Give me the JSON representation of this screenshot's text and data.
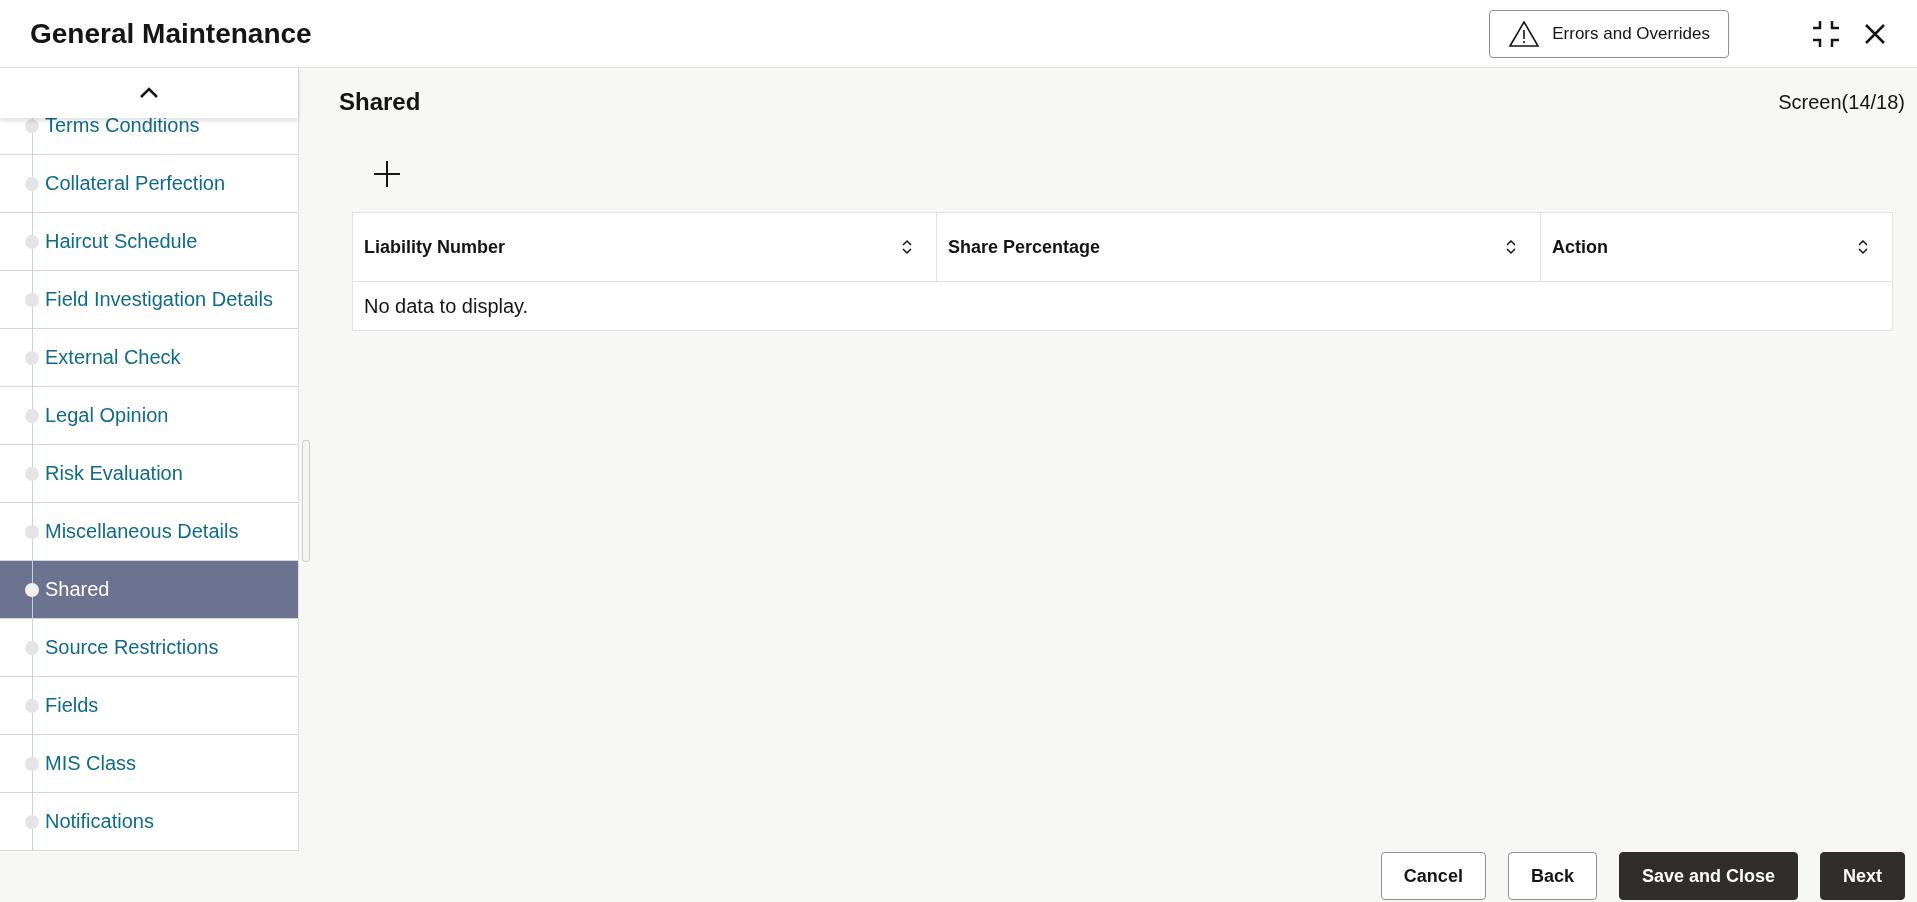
{
  "window": {
    "title": "General Maintenance"
  },
  "header_actions": {
    "errors_button": "Errors and Overrides"
  },
  "sidebar": {
    "items": [
      {
        "label": "Terms Conditions",
        "selected": false
      },
      {
        "label": "Collateral Perfection",
        "selected": false
      },
      {
        "label": "Haircut Schedule",
        "selected": false
      },
      {
        "label": "Field Investigation Details",
        "selected": false
      },
      {
        "label": "External Check",
        "selected": false
      },
      {
        "label": "Legal Opinion",
        "selected": false
      },
      {
        "label": "Risk Evaluation",
        "selected": false
      },
      {
        "label": "Miscellaneous Details",
        "selected": false
      },
      {
        "label": "Shared",
        "selected": true
      },
      {
        "label": "Source Restrictions",
        "selected": false
      },
      {
        "label": "Fields",
        "selected": false
      },
      {
        "label": "MIS Class",
        "selected": false
      },
      {
        "label": "Notifications",
        "selected": false
      }
    ]
  },
  "content": {
    "title": "Shared",
    "screen_counter": "Screen(14/18)"
  },
  "table": {
    "columns": [
      "Liability Number",
      "Share Percentage",
      "Action"
    ],
    "empty_message": "No data to display."
  },
  "footer": {
    "buttons": [
      {
        "label": "Cancel",
        "kind": "secondary"
      },
      {
        "label": "Back",
        "kind": "secondary"
      },
      {
        "label": "Save and Close",
        "kind": "primary"
      },
      {
        "label": "Next",
        "kind": "primary"
      }
    ]
  }
}
